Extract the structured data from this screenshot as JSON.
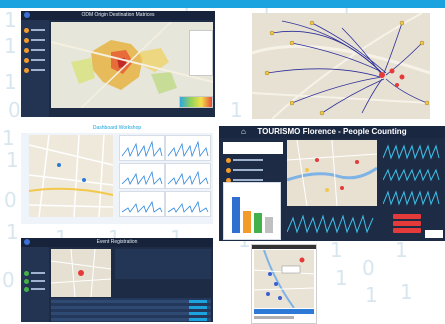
{
  "titles": {
    "od_matrix": "ODM Origin Destination Matrices",
    "dashboard": "Dashboard Workshop",
    "tourismo": "TOURISMO Florence - People Counting",
    "event": "Event Registration"
  },
  "colors": {
    "accent": "#1aa3df",
    "dark_bg": "#1d2b45",
    "orange": "#f39c2a",
    "red": "#e43a3a"
  },
  "icons": {
    "home": "home-icon",
    "logo": "snap4city-logo-icon",
    "marker": "map-marker-icon"
  }
}
